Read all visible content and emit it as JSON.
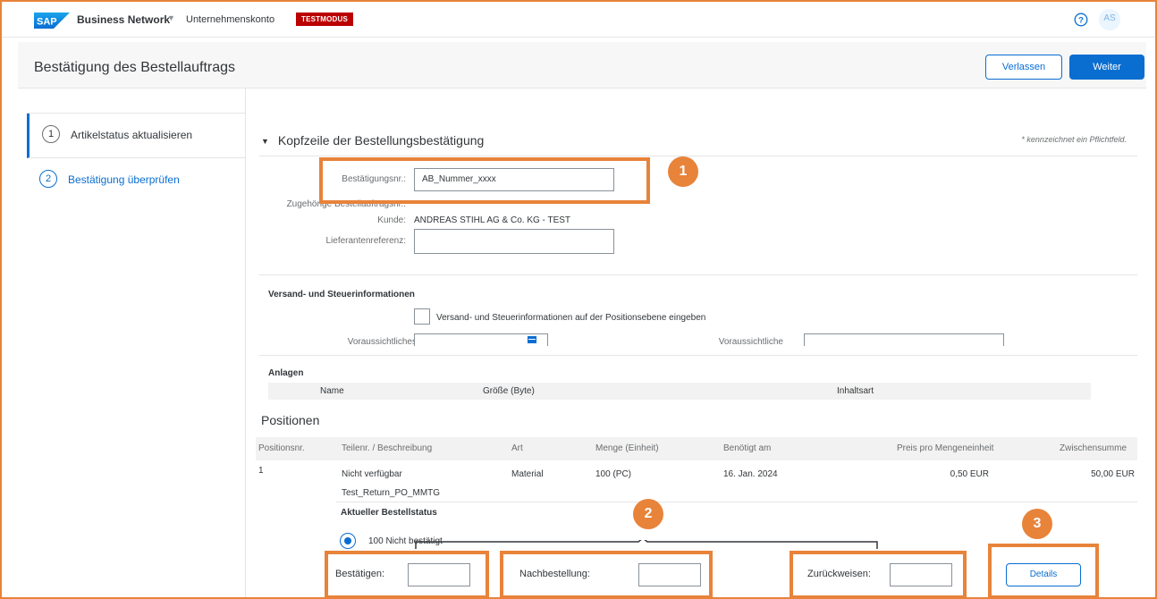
{
  "shell": {
    "logo": "SAP",
    "product": "Business Network",
    "account": "Unternehmenskonto",
    "badge": "TESTMODUS",
    "avatar": "AS",
    "icons": [
      "sap-logo",
      "chevron-down-icon",
      "help-icon"
    ]
  },
  "header": {
    "title": "Bestätigung des Bestellauftrags",
    "leave_label": "Verlassen",
    "next_label": "Weiter"
  },
  "nav": {
    "steps": [
      {
        "number": "1",
        "label": "Artikelstatus aktualisieren"
      },
      {
        "number": "2",
        "label": "Bestätigung überprüfen"
      }
    ]
  },
  "form": {
    "section_title": "Kopfzeile der Bestellungsbestätigung",
    "required_note": "* kennzeichnet ein Pflichtfeld.",
    "confirmation_label": "Bestätigungsnr.:",
    "confirmation_value": "AB_Nummer_xxxx",
    "related_label": "Zugehörige Bestellauftragsnr.:",
    "customer_label": "Kunde:",
    "customer_value": "ANDREAS STIHL AG & Co. KG - TEST",
    "supplier_ref_label": "Lieferantenreferenz:",
    "supplier_ref_value": ""
  },
  "shipping": {
    "title": "Versand- und Steuerinformationen",
    "checkbox_label": "Versand- und Steuerinformationen auf der Positionsebene eingeben",
    "estimated_left_label": "Voraussichtliches",
    "estimated_right_label": "Voraussichtliche"
  },
  "attachments": {
    "title": "Anlagen",
    "columns": [
      "Name",
      "Größe (Byte)",
      "Inhaltsart"
    ]
  },
  "positions": {
    "title": "Positionen",
    "columns": [
      "Positionsnr.",
      "Teilenr. / Beschreibung",
      "Art",
      "Menge (Einheit)",
      "Benötigt am",
      "Preis pro Mengeneinheit",
      "Zwischensumme"
    ],
    "rows": [
      {
        "number": "1",
        "part": "Nicht verfügbar",
        "description": "Test_Return_PO_MMTG",
        "type": "Material",
        "quantity": "100 (PC)",
        "needed": "16. Jan. 2024",
        "price": "0,50 EUR",
        "subtotal": "50,00 EUR"
      }
    ],
    "status_title": "Aktueller Bestellstatus",
    "status_value": "100 Nicht bestätigt",
    "confirm_label": "Bestätigen:",
    "backorder_label": "Nachbestellung:",
    "reject_label": "Zurückweisen:",
    "details_label": "Details"
  },
  "callouts": [
    "1",
    "2",
    "3"
  ],
  "colors": {
    "accent": "#e8833a",
    "primary": "#0a6ed1",
    "badge": "#bb0000"
  }
}
